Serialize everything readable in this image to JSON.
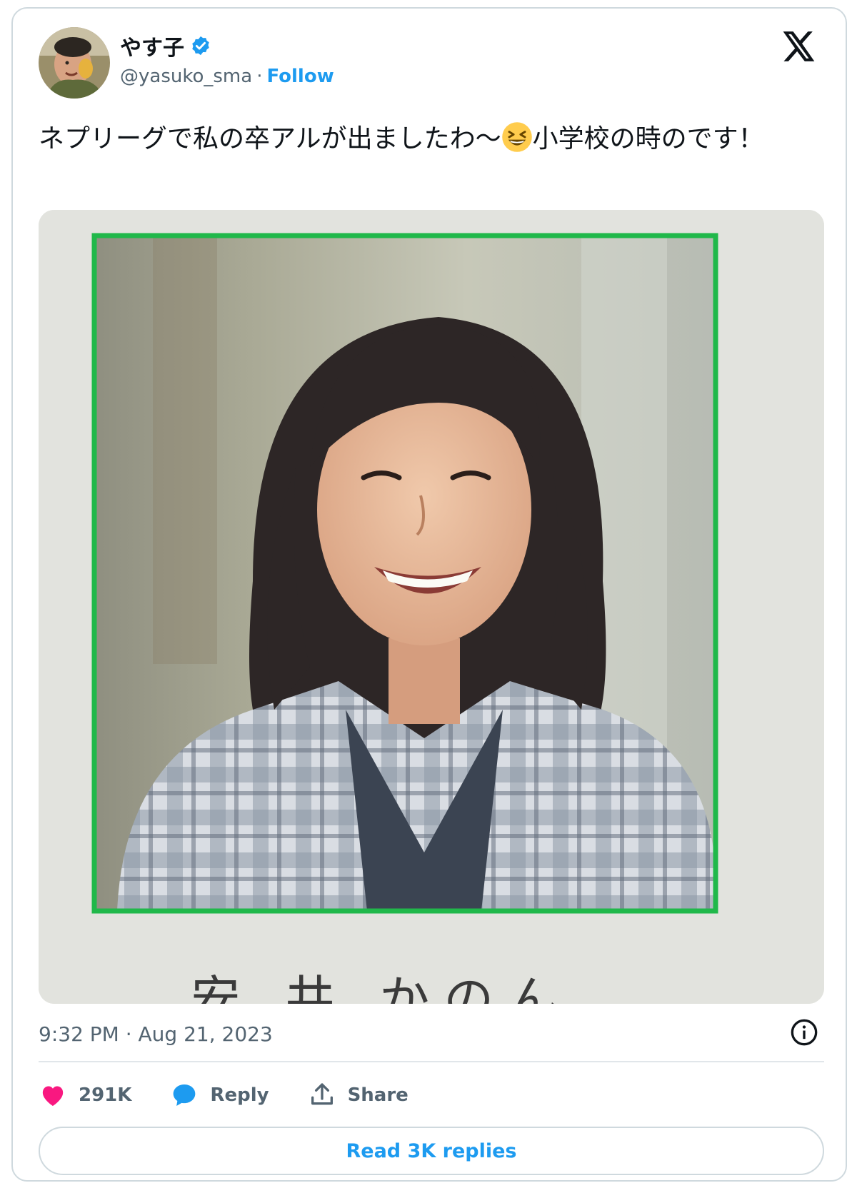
{
  "author": {
    "display_name": "やす子",
    "handle": "@yasuko_sma",
    "separator": "·",
    "follow_label": "Follow",
    "verified": true
  },
  "tweet": {
    "text_before_emoji": "ネプリーグで私の卒アルが出ましたわ〜",
    "emoji": "grinning-squinting-face",
    "text_after_emoji": "小学校の時のです！",
    "timestamp": "9:32 PM · Aug 21, 2023"
  },
  "media": {
    "caption_fragment": "安 井 かのん"
  },
  "actions": {
    "likes_count": "291K",
    "reply_label": "Reply",
    "share_label": "Share",
    "read_replies_label": "Read 3K replies"
  },
  "colors": {
    "accent": "#1d9bf0",
    "like": "#f91880",
    "text": "#0f1419",
    "secondary": "#536471",
    "border": "#cfd9de",
    "photo_frame": "#20b84a"
  },
  "icons": [
    "verified-badge-icon",
    "x-logo-icon",
    "info-icon",
    "heart-icon",
    "reply-bubble-icon",
    "share-icon"
  ]
}
